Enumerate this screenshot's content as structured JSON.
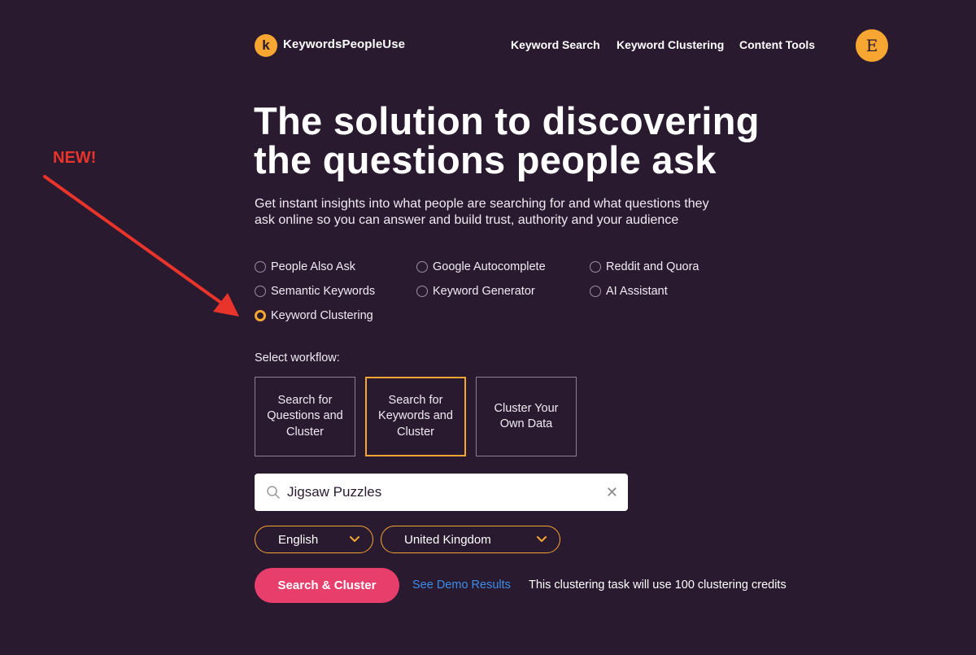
{
  "header": {
    "logo_mark": "k",
    "brand": "KeywordsPeopleUse",
    "nav": [
      "Keyword Search",
      "Keyword Clustering",
      "Content Tools"
    ],
    "avatar_initial": "E"
  },
  "annotation": {
    "label": "NEW!",
    "color": "#e8342b"
  },
  "hero": {
    "title_line1": "The solution to discovering",
    "title_line2": "the questions people ask",
    "subtitle_line1": "Get instant insights into what people are searching for and what questions they",
    "subtitle_line2": "ask online so you can answer and build trust, authority and your audience"
  },
  "tools": {
    "options": [
      {
        "label": "People Also Ask",
        "checked": false
      },
      {
        "label": "Google Autocomplete",
        "checked": false
      },
      {
        "label": "Reddit and Quora",
        "checked": false
      },
      {
        "label": "Semantic Keywords",
        "checked": false
      },
      {
        "label": "Keyword Generator",
        "checked": false
      },
      {
        "label": "AI Assistant",
        "checked": false
      },
      {
        "label": "Keyword Clustering",
        "checked": true
      }
    ]
  },
  "workflow": {
    "label": "Select workflow:",
    "cards": [
      {
        "label": "Search for Questions and Cluster",
        "active": false
      },
      {
        "label": "Search for Keywords and Cluster",
        "active": true
      },
      {
        "label": "Cluster Your Own Data",
        "active": false
      }
    ]
  },
  "search": {
    "value": "Jigsaw Puzzles",
    "icon": "search-icon",
    "clear_icon": "close-icon"
  },
  "filters": {
    "language": "English",
    "country": "United Kingdom"
  },
  "actions": {
    "primary_label": "Search & Cluster",
    "demo_label": "See Demo Results",
    "credit_note": "This clustering task will use 100 clustering credits"
  },
  "colors": {
    "background": "#2a1a30",
    "accent": "#f7a632",
    "primary_button": "#e83e6c",
    "link": "#3b8de8"
  }
}
